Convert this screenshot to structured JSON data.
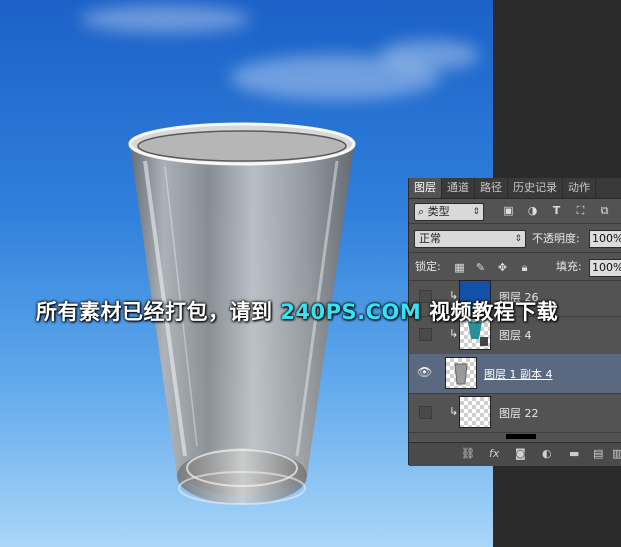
{
  "watermark": {
    "prefix": "所有素材已经打包，请到",
    "brand": "240PS.COM",
    "suffix": "视频教程下载"
  },
  "layers_panel": {
    "tabs": [
      {
        "label": "图层",
        "active": true
      },
      {
        "label": "通道",
        "active": false
      },
      {
        "label": "路径",
        "active": false
      },
      {
        "label": "历史记录",
        "active": false
      },
      {
        "label": "动作",
        "active": false
      }
    ],
    "filter": {
      "search_glyph": "⌕",
      "value": "类型"
    },
    "blend_mode": "正常",
    "opacity_label": "不透明度:",
    "opacity_value": "100%",
    "lock_label": "锁定:",
    "fill_label": "填充:",
    "fill_value": "100%",
    "layers": [
      {
        "name": "图层 26",
        "visible": false,
        "clipped": true,
        "selected": false
      },
      {
        "name": "图层 4",
        "visible": false,
        "clipped": true,
        "selected": false
      },
      {
        "name": "图层 1 副本 4",
        "visible": true,
        "clipped": false,
        "selected": true
      },
      {
        "name": "图层 22",
        "visible": false,
        "clipped": true,
        "selected": false
      }
    ],
    "footer_icons": [
      "link-icon",
      "fx-icon",
      "mask-icon",
      "adjustment-icon",
      "folder-icon",
      "new-layer-icon",
      "trash-icon"
    ]
  },
  "colors": {
    "sky_top": "#1c61c7",
    "sky_bottom": "#a9d6f8",
    "brand": "#37e2f4",
    "selected_layer": "#5a6880",
    "panel_bg": "#535353"
  }
}
